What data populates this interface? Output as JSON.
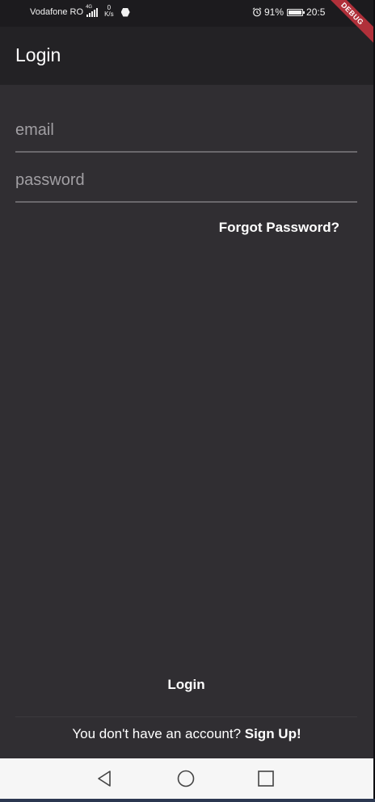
{
  "status_bar": {
    "carrier": "Vodafone RO",
    "network": "4G",
    "speed_value": "0",
    "speed_unit": "K/s",
    "battery": "91%",
    "time": "20:5",
    "debug_label": "DEBUG"
  },
  "app_bar": {
    "title": "Login"
  },
  "form": {
    "email_placeholder": "email",
    "password_placeholder": "password",
    "forgot_label": "Forgot Password?",
    "login_label": "Login",
    "signup_prompt": "You don't have an account? ",
    "signup_link": "Sign Up!"
  },
  "nav_bar": {
    "back_icon": "triangle-back-icon",
    "home_icon": "circle-home-icon",
    "recents_icon": "square-recents-icon"
  },
  "colors": {
    "background": "#302e32",
    "app_bar": "#232225",
    "status_bar": "#1c1b1e",
    "debug_ribbon": "#b0303a",
    "nav_bar": "#f6f6f6"
  }
}
